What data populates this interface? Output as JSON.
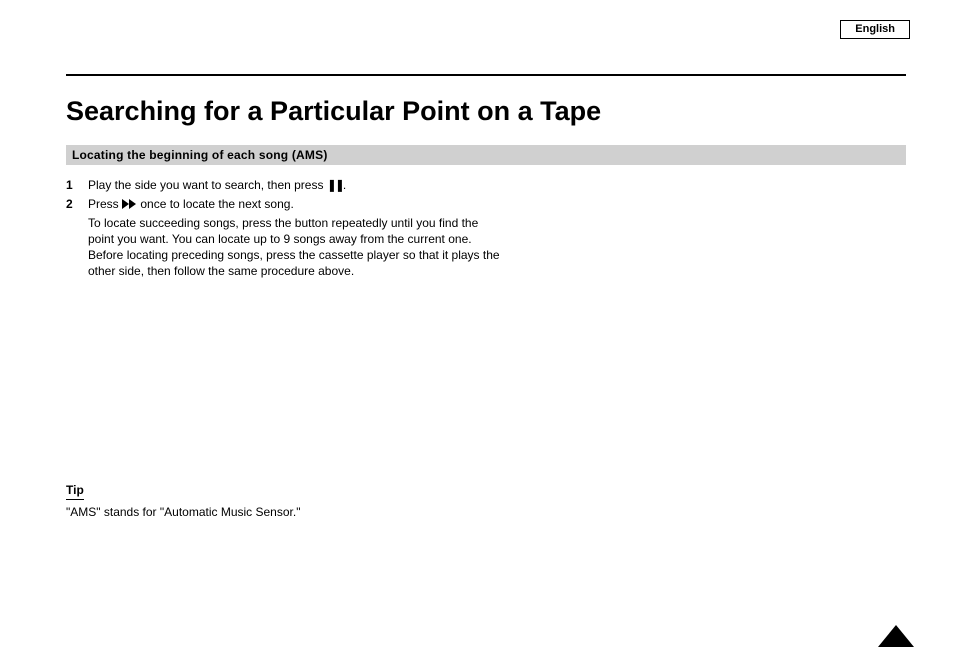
{
  "tab": "English",
  "title": "Searching for a Particular Point on a Tape",
  "section": "Locating the beginning of each song (AMS)",
  "steps": {
    "s1": {
      "num": "1",
      "text_a": "Play the side you want to search, then press ",
      "text_b": "."
    },
    "s2": {
      "num": "2",
      "text_a": "Press ",
      "text_b": " once to locate the next song."
    },
    "s3": {
      "num": "",
      "texts": [
        "To locate succeeding songs, press the button repeatedly until you find the",
        "point you want. You can locate up to 9 songs away from the current one.",
        "Before locating preceding songs, press the cassette player so that it plays the",
        "other side, then follow the same procedure above."
      ]
    }
  },
  "tip": {
    "title": "Tip",
    "text": "\"AMS\" stands for \"Automatic Music Sensor.\""
  }
}
